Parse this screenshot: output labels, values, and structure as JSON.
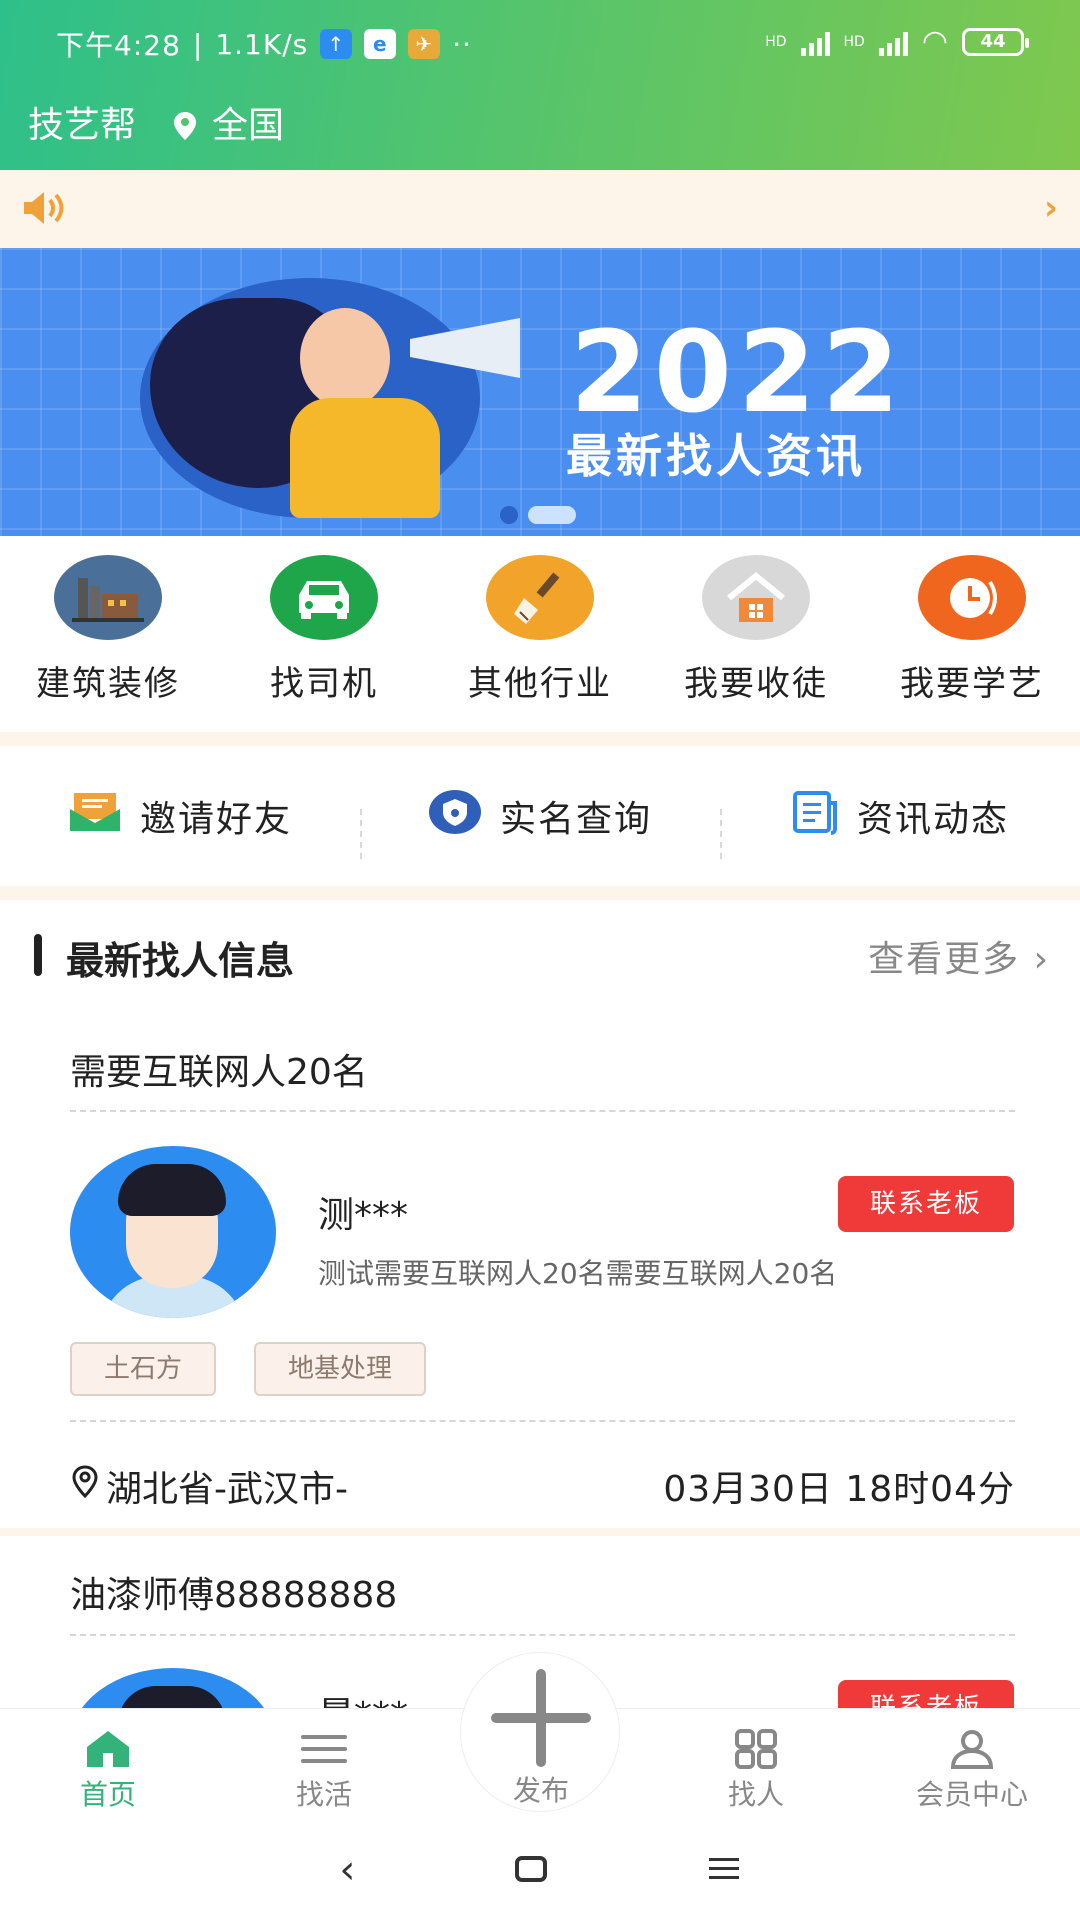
{
  "status_bar": {
    "time": "下午4:28",
    "speed": "1.1K/s",
    "battery": "44",
    "hd1": "HD",
    "hd2": "HD"
  },
  "header": {
    "app_name": "技艺帮",
    "location": "全国",
    "gradient_start": "#2ec08a",
    "gradient_end": "#7fc84e"
  },
  "banner": {
    "year": "2022",
    "subtitle": "最新找人资讯"
  },
  "categories": [
    {
      "label": "建筑装修",
      "icon": "factory-icon",
      "color": "#4a6f99"
    },
    {
      "label": "找司机",
      "icon": "car-icon",
      "color": "#1fa64a"
    },
    {
      "label": "其他行业",
      "icon": "brush-icon",
      "color": "#f2a32a"
    },
    {
      "label": "我要收徒",
      "icon": "house-icon",
      "color": "#d8d8d8"
    },
    {
      "label": "我要学艺",
      "icon": "clock-icon",
      "color": "#f0661f"
    }
  ],
  "quick_links": [
    {
      "label": "邀请好友",
      "icon": "mail-icon"
    },
    {
      "label": "实名查询",
      "icon": "shield-icon"
    },
    {
      "label": "资讯动态",
      "icon": "document-icon"
    }
  ],
  "section": {
    "title": "最新找人信息",
    "more": "查看更多"
  },
  "jobs": [
    {
      "title": "需要互联网人20名",
      "poster": "测***",
      "description": "测试需要互联网人20名需要互联网人20名",
      "contact": "联系老板",
      "tags": [
        "土石方",
        "地基处理"
      ],
      "location": "湖北省-武汉市-",
      "date": "03月30日 18时04分"
    },
    {
      "title": "油漆师傅88888888",
      "poster": "晨***",
      "contact": "联系老板"
    }
  ],
  "bottom_nav": [
    {
      "label": "首页",
      "icon": "home-icon",
      "active": true
    },
    {
      "label": "找活",
      "icon": "list-icon",
      "active": false
    },
    {
      "label": "发布",
      "icon": "plus-icon",
      "active": false
    },
    {
      "label": "找人",
      "icon": "grid-icon",
      "active": false
    },
    {
      "label": "会员中心",
      "icon": "user-icon",
      "active": false
    }
  ],
  "accent_color": "#33b37a",
  "contact_color": "#f03a3a"
}
